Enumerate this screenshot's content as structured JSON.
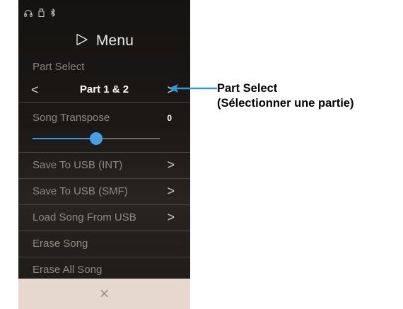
{
  "menu": {
    "title": "Menu",
    "part_select_label": "Part Select",
    "part_value": "Part 1 & 2",
    "prev_glyph": "<",
    "next_glyph": ">",
    "song_transpose_label": "Song Transpose",
    "song_transpose_value": "0",
    "transpose_level_fraction": 0.5,
    "items": [
      {
        "label": "Save To USB (INT)",
        "chevron": ">"
      },
      {
        "label": "Save To USB (SMF)",
        "chevron": ">"
      },
      {
        "label": "Load Song From USB",
        "chevron": ">"
      },
      {
        "label": "Erase Song",
        "chevron": ""
      },
      {
        "label": "Erase All Song",
        "chevron": ""
      }
    ],
    "close_glyph": "×"
  },
  "status_icons": [
    "headphones-icon",
    "usb-icon",
    "bluetooth-icon"
  ],
  "annotation": {
    "line1": "Part Select",
    "line2": "(Sélectionner une partie)"
  },
  "colors": {
    "accent": "#3e9be0",
    "arrow": "#3397d8",
    "bottom_bar": "#e6d8cc"
  }
}
